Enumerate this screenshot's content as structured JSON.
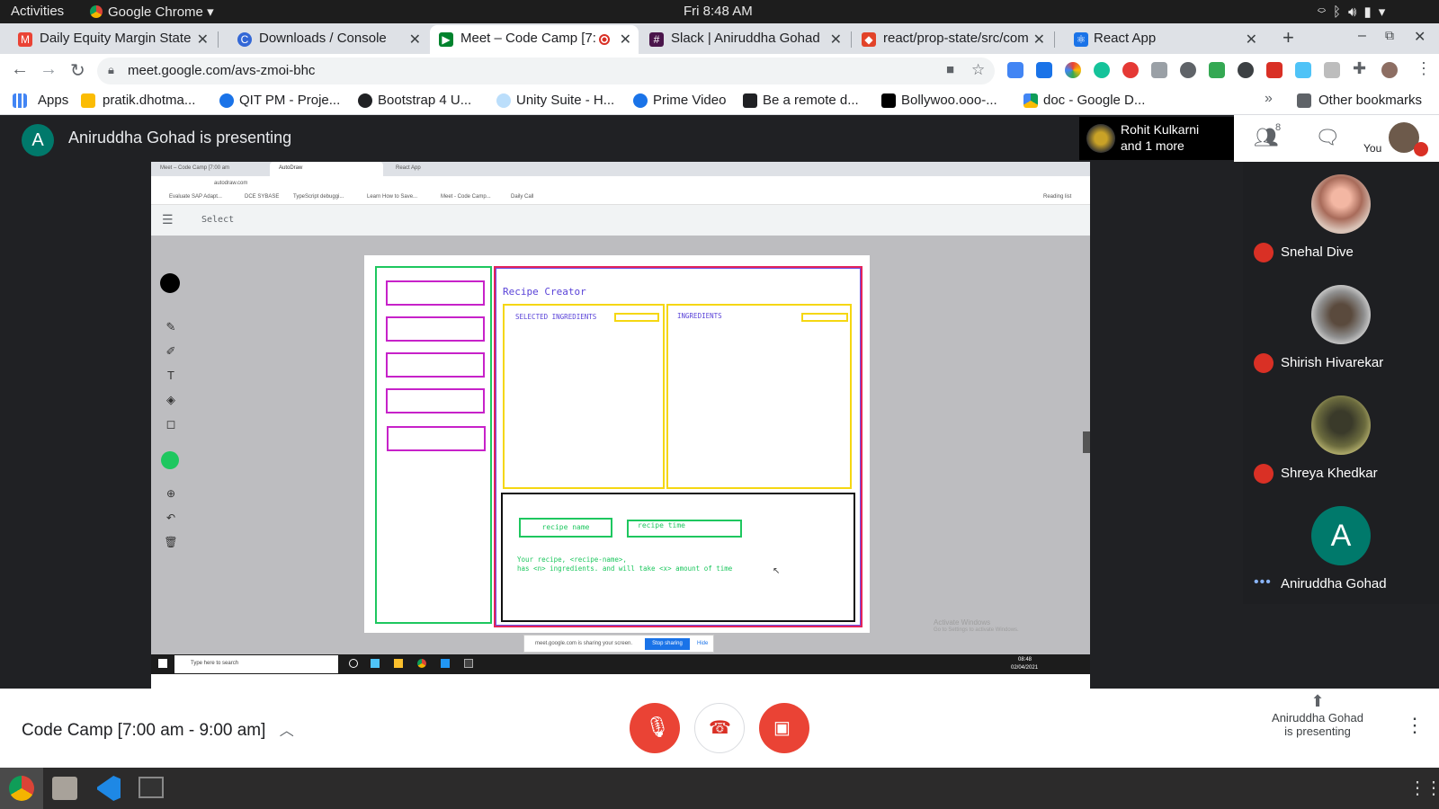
{
  "system_bar": {
    "activities": "Activities",
    "app_name": "Google Chrome",
    "clock": "Fri  8:48 AM"
  },
  "browser": {
    "tabs": [
      {
        "title": "Daily Equity Margin State",
        "icon": "gmail-icon",
        "color": "#ea4335"
      },
      {
        "title": "Downloads / Console",
        "icon": "console-icon",
        "color": "#3367d6"
      },
      {
        "title": "Meet – Code Camp [7:",
        "icon": "meet-icon",
        "color": "#00832d"
      },
      {
        "title": "Slack | Aniruddha Gohad",
        "icon": "slack-icon",
        "color": "#4a154b"
      },
      {
        "title": "react/prop-state/src/com",
        "icon": "gitlab-icon",
        "color": "#e24329"
      },
      {
        "title": "React App",
        "icon": "react-icon",
        "color": "#1a73e8"
      }
    ],
    "url": "meet.google.com/avs-zmoi-bhc",
    "bookmarks": [
      {
        "label": "Apps",
        "icon": "apps-grid-icon",
        "color": "#4285f4"
      },
      {
        "label": "pratik.dhotma...",
        "icon": "mail-icon",
        "color": "#fbbc04"
      },
      {
        "label": "QIT PM - Proje...",
        "icon": "search-icon",
        "color": "#1a73e8"
      },
      {
        "label": "Bootstrap 4 U...",
        "icon": "globe-icon",
        "color": "#202124"
      },
      {
        "label": "Unity Suite - H...",
        "icon": "unity-icon",
        "color": "#1a73e8"
      },
      {
        "label": "Prime Video",
        "icon": "play-icon",
        "color": "#1a73e8"
      },
      {
        "label": "Be a remote d...",
        "icon": "code-icon",
        "color": "#202124"
      },
      {
        "label": "Bollywoo.ooo-...",
        "icon": "bolly-icon",
        "color": "#000000"
      },
      {
        "label": "doc - Google D...",
        "icon": "drive-icon",
        "color": "#0f9d58"
      }
    ],
    "other_bookmarks": "Other bookmarks"
  },
  "meet": {
    "presenter_initial": "A",
    "presenting_title": "Aniruddha Gohad is presenting",
    "pinned_name": "Rohit Kulkarni",
    "pinned_more": "and 1 more",
    "people_count": "8",
    "you_label": "You",
    "participants": [
      {
        "name": "Snehal Dive",
        "muted": true
      },
      {
        "name": "Shirish Hivarekar",
        "muted": true
      },
      {
        "name": "Shreya Khedkar",
        "muted": true
      },
      {
        "name": "Aniruddha Gohad",
        "initial": "A",
        "muted": false
      }
    ],
    "meeting_title": "Code Camp [7:00 am - 9:00 am]",
    "presenting_status_1": "Aniruddha Gohad",
    "presenting_status_2": "is presenting"
  },
  "shared_screen": {
    "tabs": [
      "Meet – Code Camp [7:00 am",
      "AutoDraw",
      "React App"
    ],
    "url": "autodraw.com",
    "bookmarks": [
      "Evaluate SAP Adapt...",
      "DCE SYBASE",
      "TypeScript debuggi...",
      "Learn How to Save...",
      "Meet - Code Camp...",
      "Daily Call"
    ],
    "reading_list": "Reading list",
    "tool_label": "Select",
    "canvas": {
      "title": "Recipe Creator",
      "selected_ingredients": "SELECTED INGREDIENTS",
      "ingredients": "INGREDIENTS",
      "recipe_name": "recipe name",
      "recipe_time": "recipe time",
      "summary_line1": "Your recipe, <recipe-name>,",
      "summary_line2": "has <n> ingredients. and will take <x> amount of time"
    },
    "sharing_banner": "meet.google.com is sharing your screen.",
    "stop_sharing": "Stop sharing",
    "hide": "Hide",
    "win_search": "Type here to search",
    "win_time": "08:48",
    "win_date": "02/04/2021",
    "watermark_1": "Activate Windows",
    "watermark_2": "Go to Settings to activate Windows."
  }
}
